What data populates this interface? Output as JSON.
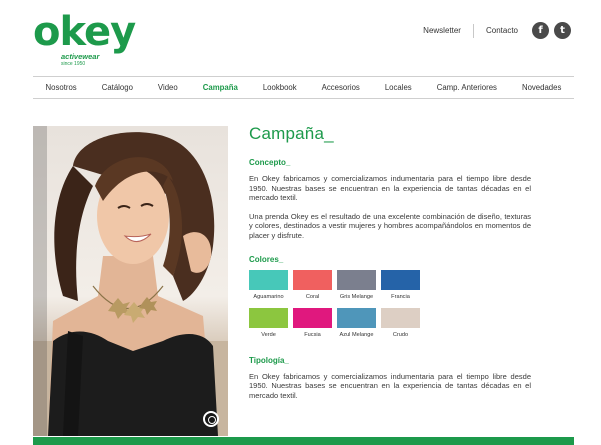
{
  "brand": {
    "name": "okey",
    "tagline": "activewear",
    "since": "since 1950",
    "color": "#1d9a4b"
  },
  "top_links": {
    "newsletter": "Newsletter",
    "contacto": "Contacto",
    "facebook_glyph": "f",
    "twitter_glyph": "t",
    "facebook_icon": "facebook-icon",
    "twitter_icon": "twitter-icon"
  },
  "nav": {
    "items": [
      "Nosotros",
      "Catálogo",
      "Video",
      "Campaña",
      "Lookbook",
      "Accesorios",
      "Locales",
      "Camp. Anteriores",
      "Novedades"
    ],
    "active": "Campaña"
  },
  "main": {
    "title": "Campaña_",
    "concepto_title": "Concepto_",
    "concepto_p1": "En Okey fabricamos y comercializamos indumentaria para el tiempo libre desde 1950. Nuestras bases se encuentran en la experiencia de tantas décadas en el mercado textil.",
    "concepto_p2": "Una prenda Okey es el resultado de una excelente combinación de diseño, texturas y colores, destinados a vestir mujeres y hombres acompañándolos en momentos de placer y disfrute.",
    "colores_title": "Colores_",
    "colors": [
      {
        "label": "Aguamarino",
        "hex": "#47c8b9"
      },
      {
        "label": "Coral",
        "hex": "#f0605f"
      },
      {
        "label": "Gris Melange",
        "hex": "#7b7f8e"
      },
      {
        "label": "Francia",
        "hex": "#2563a8"
      },
      {
        "label": "Verde",
        "hex": "#8cc63f"
      },
      {
        "label": "Fucsia",
        "hex": "#e0187e"
      },
      {
        "label": "Azul Melange",
        "hex": "#4f96ba"
      },
      {
        "label": "Crudo",
        "hex": "#ddcfc4"
      }
    ],
    "tipologia_title": "Tipología_",
    "tipologia_p1": "En Okey fabricamos y comercializamos indumentaria para el tiempo libre desde 1950. Nuestras bases se encuentran en la experiencia de tantas décadas en el mercado textil."
  }
}
